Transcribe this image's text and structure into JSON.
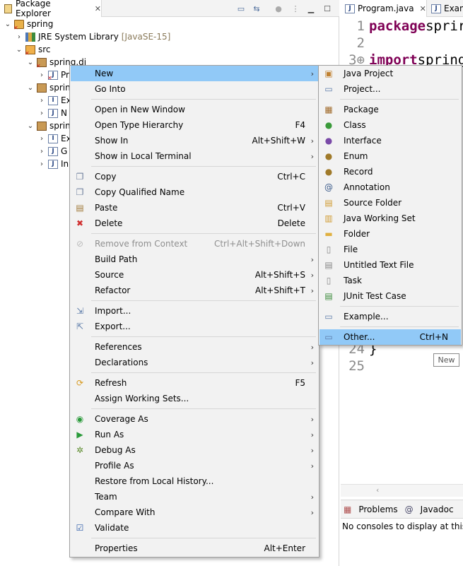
{
  "package_explorer": {
    "tab_title": "Package Explorer",
    "close_glyph": "✕",
    "toolbar_icons": [
      "collapse-all-icon",
      "link-with-editor-icon",
      "view-menu-icon",
      "minimize-icon",
      "maximize-icon"
    ],
    "tree": {
      "project": "spring",
      "jre_library": "JRE System Library",
      "jre_version": "[JavaSE-15]",
      "src": "src",
      "pkg1": "spring.di",
      "pkg1_child": "Pr",
      "pkg2": "sprin",
      "pkg2_children": [
        "Ex",
        "N"
      ],
      "pkg3": "sprin",
      "pkg3_children": [
        "Ex",
        "G",
        "In"
      ]
    }
  },
  "editor": {
    "tabs": [
      "Program.java",
      "Exam"
    ],
    "lines": [
      {
        "num": "1",
        "kw": "package",
        "rest": " sprir"
      },
      {
        "num": "2",
        "kw": "",
        "rest": ""
      },
      {
        "num": "3⊕",
        "kw": "import",
        "rest": " spring"
      },
      {
        "num": "24",
        "kw": "",
        "rest": "}"
      },
      {
        "num": "25",
        "kw": "",
        "rest": ""
      }
    ]
  },
  "bottom_panel": {
    "tabs": [
      "Problems",
      "Javadoc"
    ],
    "message": "No consoles to display at this ti"
  },
  "context_menu": {
    "items": [
      {
        "label": "New",
        "key": "",
        "submenu": true,
        "icon": ""
      },
      {
        "label": "Go Into",
        "key": "",
        "submenu": false,
        "icon": ""
      },
      {
        "label": "Open in New Window",
        "key": "",
        "submenu": false,
        "icon": ""
      },
      {
        "label": "Open Type Hierarchy",
        "key": "F4",
        "submenu": false,
        "icon": ""
      },
      {
        "label": "Show In",
        "key": "Alt+Shift+W",
        "submenu": true,
        "icon": ""
      },
      {
        "label": "Show in Local Terminal",
        "key": "",
        "submenu": true,
        "icon": ""
      },
      {
        "label": "Copy",
        "key": "Ctrl+C",
        "submenu": false,
        "icon": "copy-icon"
      },
      {
        "label": "Copy Qualified Name",
        "key": "",
        "submenu": false,
        "icon": "copy-qualified-icon"
      },
      {
        "label": "Paste",
        "key": "Ctrl+V",
        "submenu": false,
        "icon": "paste-icon"
      },
      {
        "label": "Delete",
        "key": "Delete",
        "submenu": false,
        "icon": "delete-icon"
      },
      {
        "label": "Remove from Context",
        "key": "Ctrl+Alt+Shift+Down",
        "submenu": false,
        "icon": "remove-context-icon",
        "disabled": true
      },
      {
        "label": "Build Path",
        "key": "",
        "submenu": true,
        "icon": ""
      },
      {
        "label": "Source",
        "key": "Alt+Shift+S",
        "submenu": true,
        "icon": ""
      },
      {
        "label": "Refactor",
        "key": "Alt+Shift+T",
        "submenu": true,
        "icon": ""
      },
      {
        "label": "Import...",
        "key": "",
        "submenu": false,
        "icon": "import-icon"
      },
      {
        "label": "Export...",
        "key": "",
        "submenu": false,
        "icon": "export-icon"
      },
      {
        "label": "References",
        "key": "",
        "submenu": true,
        "icon": ""
      },
      {
        "label": "Declarations",
        "key": "",
        "submenu": true,
        "icon": ""
      },
      {
        "label": "Refresh",
        "key": "F5",
        "submenu": false,
        "icon": "refresh-icon"
      },
      {
        "label": "Assign Working Sets...",
        "key": "",
        "submenu": false,
        "icon": ""
      },
      {
        "label": "Coverage As",
        "key": "",
        "submenu": true,
        "icon": "coverage-icon"
      },
      {
        "label": "Run As",
        "key": "",
        "submenu": true,
        "icon": "run-icon"
      },
      {
        "label": "Debug As",
        "key": "",
        "submenu": true,
        "icon": "debug-icon"
      },
      {
        "label": "Profile As",
        "key": "",
        "submenu": true,
        "icon": ""
      },
      {
        "label": "Restore from Local History...",
        "key": "",
        "submenu": false,
        "icon": ""
      },
      {
        "label": "Team",
        "key": "",
        "submenu": true,
        "icon": ""
      },
      {
        "label": "Compare With",
        "key": "",
        "submenu": true,
        "icon": ""
      },
      {
        "label": "Validate",
        "key": "",
        "submenu": false,
        "icon": "validate-icon"
      },
      {
        "label": "Properties",
        "key": "Alt+Enter",
        "submenu": false,
        "icon": ""
      }
    ],
    "highlighted": "New"
  },
  "new_submenu": {
    "items": [
      {
        "label": "Java Project",
        "key": "",
        "icon": "java-project-icon"
      },
      {
        "label": "Project...",
        "key": "",
        "icon": "project-icon"
      },
      {
        "label": "Package",
        "key": "",
        "icon": "package-icon"
      },
      {
        "label": "Class",
        "key": "",
        "icon": "class-icon"
      },
      {
        "label": "Interface",
        "key": "",
        "icon": "interface-icon"
      },
      {
        "label": "Enum",
        "key": "",
        "icon": "enum-icon"
      },
      {
        "label": "Record",
        "key": "",
        "icon": "record-icon"
      },
      {
        "label": "Annotation",
        "key": "",
        "icon": "annotation-icon"
      },
      {
        "label": "Source Folder",
        "key": "",
        "icon": "source-folder-icon"
      },
      {
        "label": "Java Working Set",
        "key": "",
        "icon": "working-set-icon"
      },
      {
        "label": "Folder",
        "key": "",
        "icon": "folder-icon"
      },
      {
        "label": "File",
        "key": "",
        "icon": "file-icon"
      },
      {
        "label": "Untitled Text File",
        "key": "",
        "icon": "text-file-icon"
      },
      {
        "label": "Task",
        "key": "",
        "icon": "task-icon"
      },
      {
        "label": "JUnit Test Case",
        "key": "",
        "icon": "junit-icon"
      },
      {
        "label": "Example...",
        "key": "",
        "icon": "example-icon"
      },
      {
        "label": "Other...",
        "key": "Ctrl+N",
        "icon": "other-icon"
      }
    ],
    "highlighted": "Other..."
  },
  "tooltip": "New",
  "colors": {
    "menu_bg": "#f2f2f2",
    "highlight": "#91c9f7",
    "keyword": "#7f0055"
  }
}
